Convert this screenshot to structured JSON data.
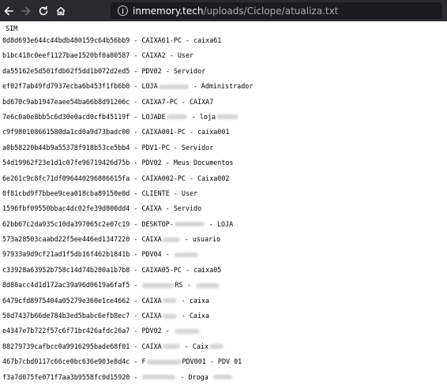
{
  "browser": {
    "url_domain": "inmemory.tech",
    "url_path": "/uploads/Ciclope/atualiza.txt",
    "back_icon": "arrow-left-icon",
    "forward_icon": "arrow-right-icon",
    "reload_icon": "reload-icon",
    "home_icon": "home-icon",
    "info_icon": "info-icon"
  },
  "file": {
    "header": "SIM",
    "lines": [
      {
        "parts": [
          "0d8d693e644c44bdb480159c64b56bb9 - CAIXA61-PC - caixa61"
        ]
      },
      {
        "parts": [
          "b1bc418c0eef1127bae1520bf0a80587 - CAIXA2 - User"
        ]
      },
      {
        "parts": [
          "da55162e5d501fdb62f5dd1b072d2ed5 - PDV02 - Servidor"
        ]
      },
      {
        "parts": [
          "ef02f7ab49fd7937ecba6b453f1fb6b0 - LOJA",
          "",
          " - Administrador"
        ],
        "blur": [
          38
        ]
      },
      {
        "parts": [
          "bd670c9ab1947eaee54ba66b8d91206c - CAIXA7-PC - CAIXA7"
        ]
      },
      {
        "parts": [
          "7e6c0a0e8bb5c6d30e0acd0cfb45119f - LOJADE",
          "",
          " - loja",
          ""
        ],
        "blur": [
          26,
          28
        ]
      },
      {
        "parts": [
          "c9f980108661580da1cd0a9d73badc00 - CAIXA001-PC - caixa001"
        ]
      },
      {
        "parts": [
          "a0b58220b44b9a55378f918b53ce5bb4 - PDV1-PC - Servidor"
        ]
      },
      {
        "parts": [
          "54d19962f23e1d1c07fe96719426d75b - PDV02 - Meus Documentos"
        ]
      },
      {
        "parts": [
          "6e261c9c8fc71df096440296806615fa - CAIXA002-PC - Caixa002"
        ]
      },
      {
        "parts": [
          "0f81cbd9f7bbee9cea018cba89150e0d - CLIENTE - User"
        ]
      },
      {
        "parts": [
          "1596fbf09550bbac4dc02fe39d800dd4 - CAIXA - Servido"
        ]
      },
      {
        "parts": [
          "62bb67c2da935c10da397065c2e07c19 - DESKTOP-",
          "",
          " - LOJA"
        ],
        "blur": [
          38
        ]
      },
      {
        "parts": [
          "573a28503caabd22f5ee446ed1347220 - CAIXA",
          "",
          " - usuario"
        ],
        "blur": [
          22
        ]
      },
      {
        "parts": [
          "97933a9d9cf21ad1f5db16f462b1841b - PDV04 - ",
          ""
        ],
        "blur": [
          30
        ]
      },
      {
        "parts": [
          "c33928a63952b758c14d74b280a1b7b8 - CAIXA05-PC - caixa05"
        ]
      },
      {
        "parts": [
          "8d80acc4d1d172ac39a96d0619a6faf5 - ",
          "",
          "RS - ",
          ""
        ],
        "blur": [
          40,
          30
        ]
      },
      {
        "parts": [
          "6479cfd8975404a05279e360e1ce4662 - CAIXA",
          "",
          " - caixa"
        ],
        "blur": [
          18
        ]
      },
      {
        "parts": [
          "50d7437b66de784b3ed5babc6efb8ec7 - CAIXA",
          "",
          " - Caixa"
        ],
        "blur": [
          18
        ]
      },
      {
        "parts": [
          "e4347e7b722f57c6f71bc426afdc26a7 - PDV02 - ",
          ""
        ],
        "blur": [
          32
        ]
      },
      {
        "parts": [
          "88279739cafbcc0a9916295bade68f01 - CAIXA",
          "",
          " - Caix",
          ""
        ],
        "blur": [
          22,
          18
        ]
      },
      {
        "parts": [
          "467b7cbd0117c66ce0bc636e903e8d4c - F",
          "",
          "PDV001 - PDV 01"
        ],
        "blur": [
          44
        ]
      },
      {
        "parts": [
          "f3a7d075fe071f7aa3b9558fc0d15920 - ",
          "",
          " - Droga ",
          ""
        ],
        "blur": [
          42,
          24
        ]
      }
    ]
  }
}
